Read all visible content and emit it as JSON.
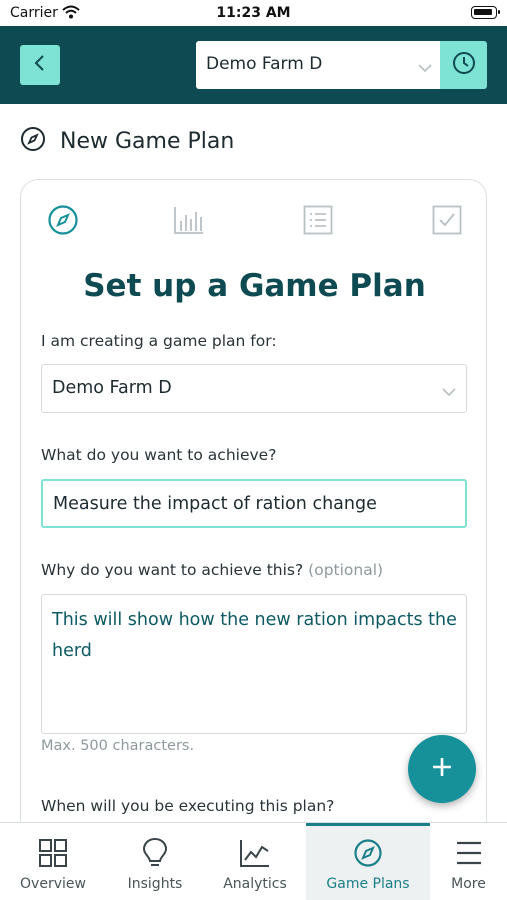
{
  "status_bar": {
    "carrier": "Carrier",
    "time": "11:23 AM"
  },
  "header": {
    "back_icon": "chevron-left-icon",
    "farm_select_value": "Demo Farm D",
    "history_icon": "clock-icon"
  },
  "page": {
    "title": "New Game Plan",
    "title_icon": "compass-icon"
  },
  "steps": [
    {
      "icon": "compass-icon",
      "active": true
    },
    {
      "icon": "bar-chart-icon",
      "active": false
    },
    {
      "icon": "list-icon",
      "active": false
    },
    {
      "icon": "checkbox-icon",
      "active": false
    }
  ],
  "form": {
    "heading": "Set up a Game Plan",
    "for_label": "I am creating a game plan for:",
    "for_value": "Demo Farm D",
    "achieve_label": "What do you want to achieve?",
    "achieve_value": "Measure the impact of ration change",
    "why_label": "Why do you want to achieve this?",
    "why_optional": "(optional)",
    "why_value": "This will show how the new ration impacts the herd",
    "why_hint": "Max. 500 characters.",
    "when_label": "When will you be executing this plan?"
  },
  "fab": {
    "icon": "plus-icon"
  },
  "tab_bar": {
    "active": "Game Plans",
    "tabs": [
      {
        "label": "Overview",
        "icon": "grid-icon"
      },
      {
        "label": "Insights",
        "icon": "lightbulb-icon"
      },
      {
        "label": "Analytics",
        "icon": "line-chart-icon"
      },
      {
        "label": "Game Plans",
        "icon": "compass-icon"
      },
      {
        "label": "More",
        "icon": "menu-icon"
      }
    ]
  },
  "colors": {
    "header_bg": "#0d4a52",
    "accent_mint": "#7ee3d4",
    "accent_teal": "#16919a",
    "heading_text": "#0d4a52"
  }
}
